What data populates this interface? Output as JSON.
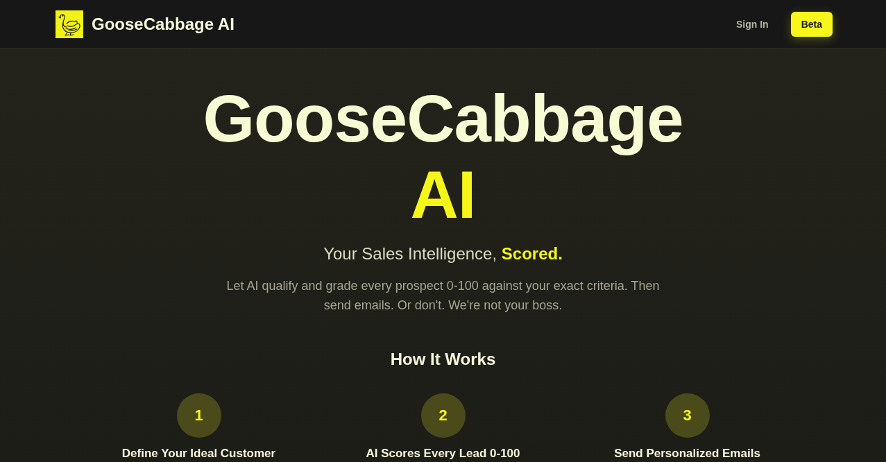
{
  "nav": {
    "brand": "GooseCabbage AI",
    "actions": [
      {
        "kind": "link",
        "label": "Sign In"
      },
      {
        "kind": "button",
        "label": "Beta"
      }
    ]
  },
  "hero": {
    "title": "GooseCabbage",
    "title_accent": "AI",
    "tagline": "Your Sales Intelligence, **Scored.**",
    "description": "Let AI qualify and grade every prospect 0-100 against your exact criteria. Then send emails. Or don't. We're not your boss."
  },
  "how_it_works": {
    "heading": "How It Works",
    "steps": [
      {
        "number": "1",
        "title": "Define Your Ideal Customer"
      },
      {
        "number": "2",
        "title": "AI Scores Every Lead 0-100"
      },
      {
        "number": "3",
        "title": "Send Personalized Emails"
      }
    ]
  }
}
